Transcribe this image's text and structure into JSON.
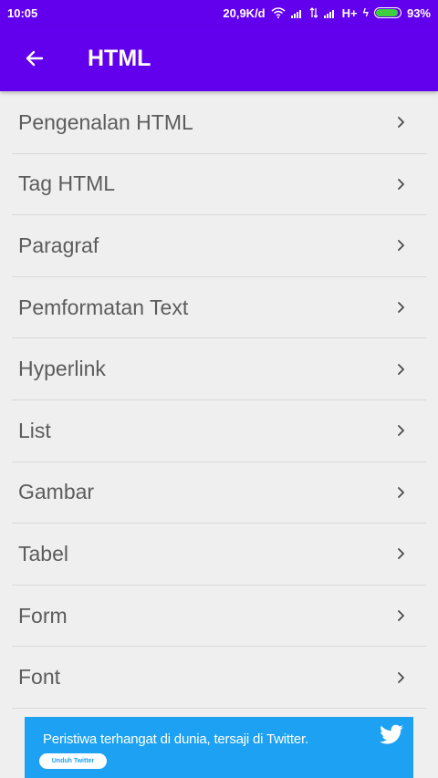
{
  "status_bar": {
    "time": "10:05",
    "speed": "20,9K/d",
    "network": "H+",
    "battery": "93%",
    "battery_level": 0.93
  },
  "header": {
    "title": "HTML"
  },
  "list": {
    "items": [
      {
        "label": "Pengenalan HTML"
      },
      {
        "label": "Tag HTML"
      },
      {
        "label": "Paragraf"
      },
      {
        "label": "Pemformatan Text"
      },
      {
        "label": "Hyperlink"
      },
      {
        "label": "List"
      },
      {
        "label": "Gambar"
      },
      {
        "label": "Tabel"
      },
      {
        "label": "Form"
      },
      {
        "label": "Font"
      }
    ]
  },
  "banner": {
    "text": "Peristiwa terhangat di dunia, tersaji di Twitter.",
    "cta": "Unduh Twitter"
  },
  "colors": {
    "primary": "#6200ee",
    "background": "#efefef",
    "banner": "#1da1f2"
  }
}
